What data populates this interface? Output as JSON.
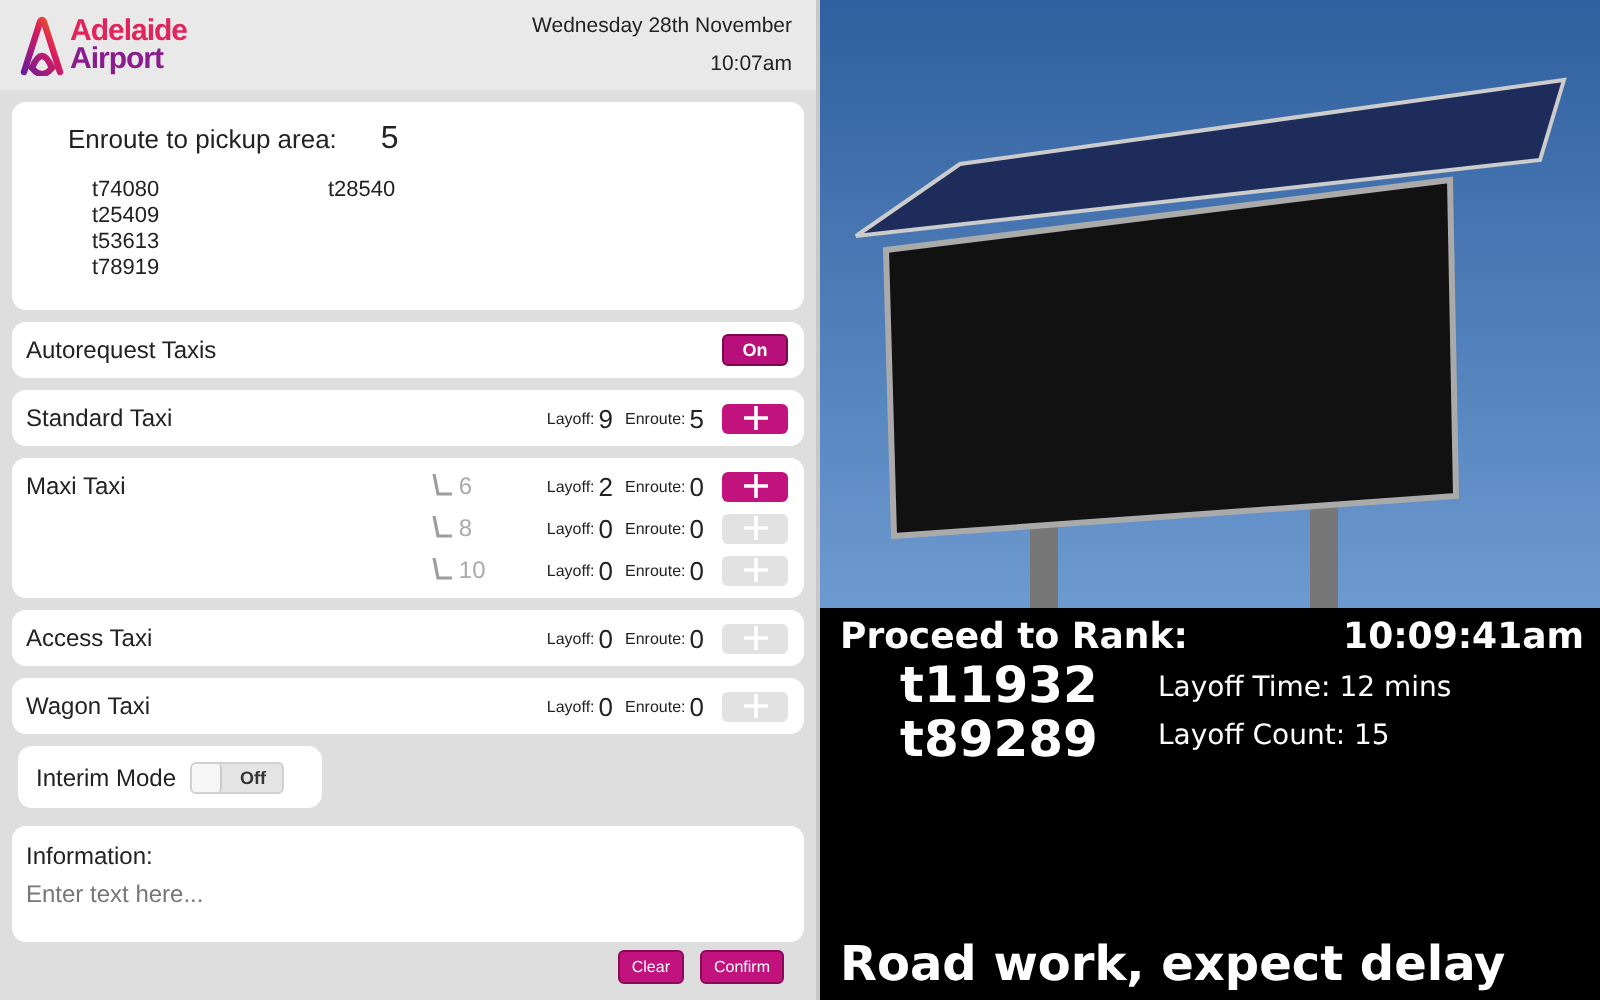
{
  "header": {
    "logo_line_1": "Adelaide",
    "logo_line_2": "Airport",
    "date": "Wednesday 28th November",
    "time": "10:07am"
  },
  "enroute": {
    "label": "Enroute to pickup area:",
    "count": "5",
    "taxis": [
      "t74080",
      "t25409",
      "t53613",
      "t78919",
      "t28540"
    ]
  },
  "autorequest": {
    "label": "Autorequest Taxis",
    "on": true,
    "toggle_label": "On"
  },
  "taxi_types": [
    {
      "name": "Standard Taxi",
      "rows": [
        {
          "layoff_label": "Layoff:",
          "layoff": "9",
          "enroute_label": "Enroute:",
          "enroute": "5",
          "disabled": false
        }
      ]
    },
    {
      "name": "Maxi Taxi",
      "rows": [
        {
          "seats": "6",
          "layoff_label": "Layoff:",
          "layoff": "2",
          "enroute_label": "Enroute:",
          "enroute": "0",
          "disabled": false
        },
        {
          "seats": "8",
          "layoff_label": "Layoff:",
          "layoff": "0",
          "enroute_label": "Enroute:",
          "enroute": "0",
          "disabled": true
        },
        {
          "seats": "10",
          "layoff_label": "Layoff:",
          "layoff": "0",
          "enroute_label": "Enroute:",
          "enroute": "0",
          "disabled": true
        }
      ]
    },
    {
      "name": "Access Taxi",
      "rows": [
        {
          "layoff_label": "Layoff:",
          "layoff": "0",
          "enroute_label": "Enroute:",
          "enroute": "0",
          "disabled": true
        }
      ]
    },
    {
      "name": "Wagon Taxi",
      "rows": [
        {
          "layoff_label": "Layoff:",
          "layoff": "0",
          "enroute_label": "Enroute:",
          "enroute": "0",
          "disabled": true
        }
      ]
    }
  ],
  "interim_mode": {
    "label": "Interim Mode",
    "on": false,
    "toggle_label": "Off"
  },
  "information": {
    "label": "Information:",
    "placeholder": "Enter text here..."
  },
  "buttons": [
    "Clear",
    "Confirm"
  ],
  "display": {
    "heading": "Proceed to Rank:",
    "time": "10:09:41am",
    "taxis": [
      "t11932",
      "t89289"
    ],
    "layoff_time": "Layoff Time: 12 mins",
    "layoff_count": "Layoff Count: 15",
    "message": "Road work, expect delay"
  }
}
